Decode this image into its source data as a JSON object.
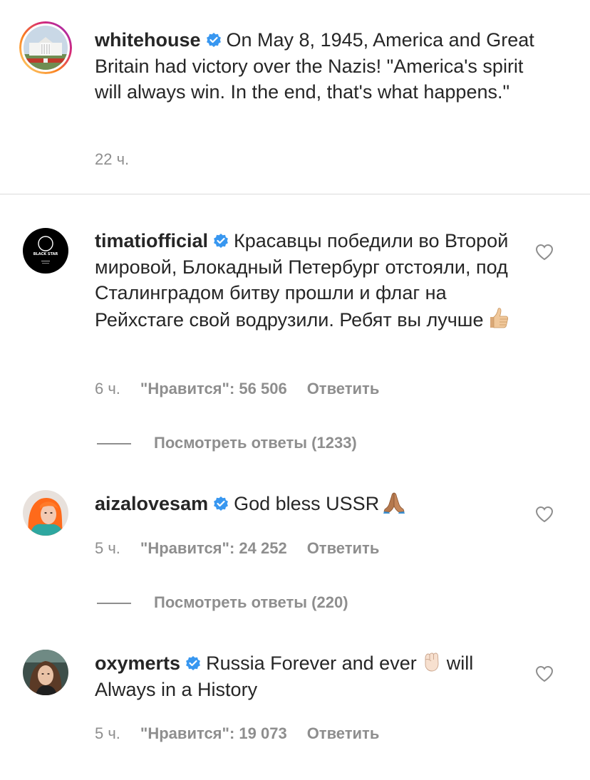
{
  "post": {
    "username": "whitehouse",
    "caption": "On May 8, 1945, America and Great Britain had victory over the Nazis! \"America's spirit will always win. In the end, that's what happens.\"",
    "time": "22 ч."
  },
  "comments": [
    {
      "username": "timatiofficial",
      "avatar_label": "BLACK STAR",
      "text": "Красавцы победили во Второй мировой, Блокадный Петербург отстояли, под Сталинградом битву прошли и флаг на Рейхстаге свой водрузили. Ребят вы лучше",
      "emoji": "thumbs-up",
      "time": "6 ч.",
      "likes_label": "\"Нравится\": 56 506",
      "reply_label": "Ответить",
      "view_replies": "Посмотреть ответы (1233)"
    },
    {
      "username": "aizalovesam",
      "text": "God bless USSR",
      "emoji": "folded-hands",
      "time": "5 ч.",
      "likes_label": "\"Нравится\": 24 252",
      "reply_label": "Ответить",
      "view_replies": "Посмотреть ответы (220)"
    },
    {
      "username": "oxymerts",
      "text_before": "Russia Forever and ever",
      "emoji": "raised-fist",
      "text_after": "will Always in a History",
      "time": "5 ч.",
      "likes_label": "\"Нравится\": 19 073",
      "reply_label": "Ответить"
    }
  ],
  "colors": {
    "text": "#262626",
    "secondary": "#8e8e8e",
    "verified": "#3897f0",
    "divider": "#dbdbdb"
  }
}
